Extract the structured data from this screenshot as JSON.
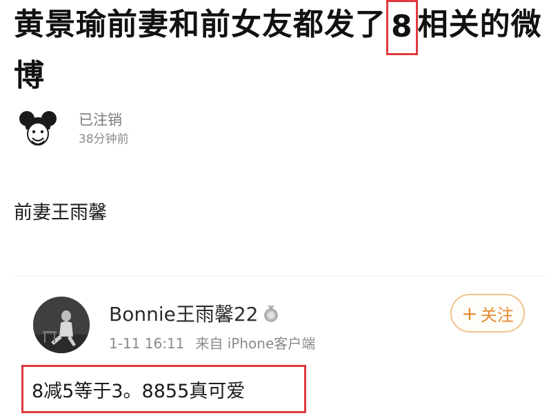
{
  "article": {
    "title_before": "黄景瑜前妻和前女友都发了",
    "title_highlight": "8",
    "title_after": "相关的微博",
    "author_name": "已注销",
    "time_ago": "38分钟前",
    "body": "前妻王雨馨"
  },
  "embedded_post": {
    "username": "Bonnie王雨馨22",
    "badge_icon": "medal-icon",
    "date": "1-11 16:11",
    "source": "来自 iPhone客户端",
    "follow_label": "关注",
    "follow_icon": "plus-icon",
    "text": "8减5等于3。8855真可爱"
  },
  "colors": {
    "highlight_border": "#e0393d",
    "follow_accent": "#e78a2e",
    "follow_border": "#f0c28a"
  }
}
